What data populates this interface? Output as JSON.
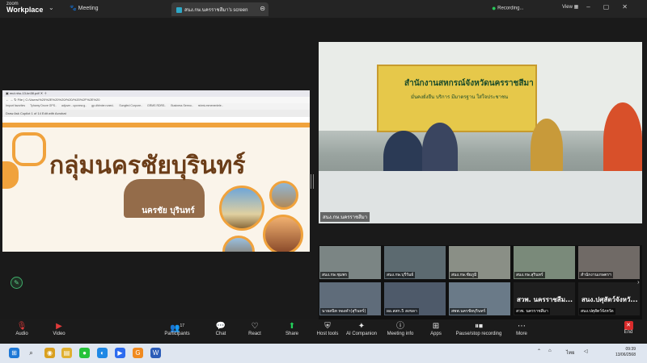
{
  "app": {
    "logo_top": "zoom",
    "logo_bottom": "Workplace",
    "meeting_label": "Meeting",
    "share_tab": "สนง.กษ.นครราชสีมา's screen",
    "recording": "Recording...",
    "view": "View"
  },
  "share": {
    "pdf_tab": "mul.nhu-13-kn38.pdf",
    "address": "C:/Users/%20%2E%20%20/%20/%20%2F%2E%20",
    "bookmarks": [
      "Import favorites",
      "Tyhamy Drove GPS..",
      "adjuvm - upcnew.g..",
      "gp.dhlrnier.runed..",
      "Sungfed Corpore..",
      "GRMS RDRS..",
      "Business Sermo..",
      "rshmi-mrnenenlele.."
    ],
    "pdf_tools": "Draw   Ask Copilot   1  of 14   Edit with Acrobat",
    "slide_title": "กลุ่มนครชัยบุรินทร์",
    "slide_brand": "นครชัย บุรินทร์"
  },
  "speaker": {
    "banner_title": "สำนักงานสหกรณ์จังหวัดนครราชสีมา",
    "banner_sub": "มั่นคงยั่งยืน  บริการ  มีมาตรฐาน  ใส่ใจประชาชน",
    "name": "สนง.กษ.นครราชสีมา"
  },
  "gallery": [
    {
      "label": "สนง.กษ.ชุมพร"
    },
    {
      "label": "สนง.กษ.บุรีรัมย์"
    },
    {
      "label": "สนง.กษ.ชัยภูมิ"
    },
    {
      "label": "สนง.กษ.สุรินทร์"
    },
    {
      "label": "สำนักงานเกษตรฯ"
    },
    {
      "label": "นายสนิท ทองคำ(สุรินทร์)"
    },
    {
      "label": "ผอ.สสก.5 สงขลา"
    },
    {
      "label": "สพพ.นครชัยบุรินทร์"
    },
    {
      "label": "สวพ. นครราชสีม...",
      "sub": "สวพ. นครราชสีมา"
    },
    {
      "label": "สนง.ปศุสัตว์จังหวั...",
      "sub": "สนง.ปศุสัตว์จังหวัด"
    }
  ],
  "toolbar": {
    "audio": "Audio",
    "video": "Video",
    "participants": "Participants",
    "participant_count": "17",
    "chat": "Chat",
    "react": "React",
    "share": "Share",
    "host_tools": "Host tools",
    "ai_companion": "AI Companion",
    "meeting_info": "Meeting info",
    "apps": "Apps",
    "record": "Pause/stop recording",
    "more": "More",
    "end": "End"
  },
  "taskbar": {
    "language": "ไทย",
    "time": "09:39",
    "date": "13/06/2568"
  }
}
